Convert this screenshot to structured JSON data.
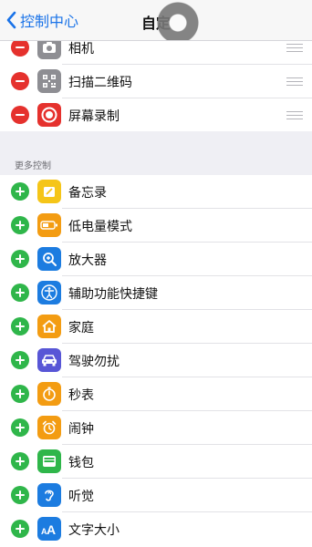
{
  "nav": {
    "back_label": "控制中心",
    "title": "自定"
  },
  "included": [
    {
      "label": "相机",
      "icon": "camera-icon",
      "color": "#8e8e93"
    },
    {
      "label": "扫描二维码",
      "icon": "qr-code-icon",
      "color": "#8e8e93"
    },
    {
      "label": "屏幕录制",
      "icon": "screen-record-icon",
      "color": "#e5312d"
    }
  ],
  "more_header": "更多控制",
  "more": [
    {
      "label": "备忘录",
      "icon": "notes-icon",
      "color": "#f5c518"
    },
    {
      "label": "低电量模式",
      "icon": "low-power-icon",
      "color": "#f39c12"
    },
    {
      "label": "放大器",
      "icon": "magnifier-icon",
      "color": "#1c7ce0"
    },
    {
      "label": "辅助功能快捷键",
      "icon": "accessibility-icon",
      "color": "#1c7ce0"
    },
    {
      "label": "家庭",
      "icon": "home-icon",
      "color": "#f39c12"
    },
    {
      "label": "驾驶勿扰",
      "icon": "car-icon",
      "color": "#5856d6"
    },
    {
      "label": "秒表",
      "icon": "stopwatch-icon",
      "color": "#f39c12"
    },
    {
      "label": "闹钟",
      "icon": "alarm-icon",
      "color": "#f39c12"
    },
    {
      "label": "钱包",
      "icon": "wallet-icon",
      "color": "#2fb64a"
    },
    {
      "label": "听觉",
      "icon": "ear-icon",
      "color": "#1c7ce0"
    },
    {
      "label": "文字大小",
      "icon": "text-size-icon",
      "color": "#1c7ce0"
    }
  ]
}
